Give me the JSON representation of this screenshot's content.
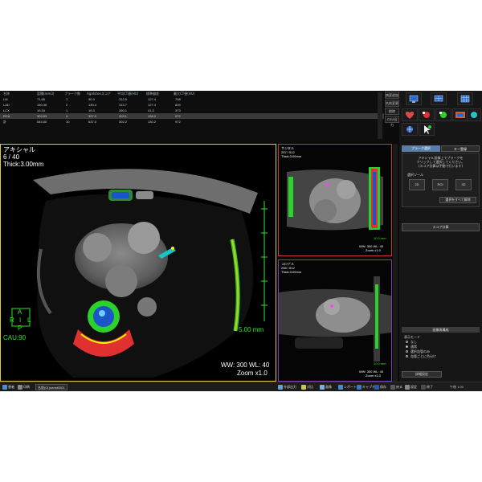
{
  "score_table": {
    "headers": [
      "名称",
      "容積(mm3)",
      "プラーク数",
      "Agatstonスコア",
      "平均CT値(HU)",
      "標準偏差",
      "最大CT値(HU)"
    ],
    "rows": [
      {
        "c": [
          "LM",
          "71.65",
          "1",
          "90.3",
          "312.9",
          "127.4",
          "798"
        ],
        "selected": false
      },
      {
        "c": [
          "LAD",
          "150.36",
          "2",
          "130.4",
          "313.7",
          "127.4",
          "839"
        ],
        "selected": false
      },
      {
        "c": [
          "LCX",
          "19.34",
          "1",
          "19.3",
          "260.1",
          "41.3",
          "373"
        ],
        "selected": false
      },
      {
        "c": [
          "RCA",
          "303.53",
          "4",
          "397.0",
          "303.1",
          "138.2",
          "972"
        ],
        "selected": true
      },
      {
        "c": [
          "計",
          "545.50",
          "10",
          "637.0",
          "302.2",
          "130.2",
          "972"
        ],
        "selected": false
      }
    ]
  },
  "table_side_buttons": [
    "病変追加",
    "名前変更",
    "削除",
    "CSV出力"
  ],
  "main_viewer": {
    "title": "アキシャル",
    "slice": "6 / 40",
    "thickness": "Thick:3.00mm",
    "orient": {
      "top": "A",
      "left": "R",
      "center": "I",
      "right": "L",
      "bottom": "P"
    },
    "angle": "CAU:90",
    "scale_label": "5.00 mm",
    "window": "WW: 300  WL: 40",
    "zoom": "Zoom x1.0"
  },
  "sub_viewer_1": {
    "title": "サジタル",
    "slice": "257 / 512",
    "thickness": "Thick:3.00mm",
    "scale_label": "10.0 mm",
    "window": "WW: 300  WL: 40",
    "zoom": "Zoom x1.0"
  },
  "sub_viewer_2": {
    "title": "コロナル",
    "slice": "258 / 512",
    "thickness": "Thick:3.00mm",
    "scale_label": "10.0 mm",
    "window": "WW: 300  WL: 40",
    "zoom": "Zoom x1.0"
  },
  "right_panel": {
    "tabs": [
      "プラーク選択",
      "キー登録"
    ],
    "instruction": [
      "アキシャル画像上でプラークを",
      "クリックして選択してください。",
      "(スコア計算は手動で行います)"
    ],
    "tool_label": "選択ツール",
    "tools": [
      "2D",
      "ROI",
      "3D"
    ],
    "select_all": "選択をすべて解除",
    "score_calc": "スコア計算",
    "display_section": "画像再構成",
    "display_mode_label": "表示モード",
    "modes": [
      {
        "label": "なし",
        "checked": false
      },
      {
        "label": "通常",
        "checked": true
      },
      {
        "label": "選択血管のみ",
        "checked": false
      },
      {
        "label": "血管ごとに色分け",
        "checked": false
      }
    ],
    "detail_settings": "詳細設定"
  },
  "taskbar": {
    "left_items": [
      "患者",
      "印刷",
      "名前(01)serial0001"
    ],
    "right_items": [
      "外部出力",
      "対比",
      "画像",
      "レポート",
      "キャプチャ",
      "保存",
      "戻る",
      "設定",
      "終了"
    ],
    "clock": "午後 1:00"
  },
  "colors": {
    "main_border": "#d8cc3c",
    "sub1_border": "#c23a3a",
    "sub2_border": "#7a3fb0",
    "scale_green": "#2be62b",
    "tab_active": "#5a7da8",
    "tab_inactive": "#2c2c2c"
  }
}
